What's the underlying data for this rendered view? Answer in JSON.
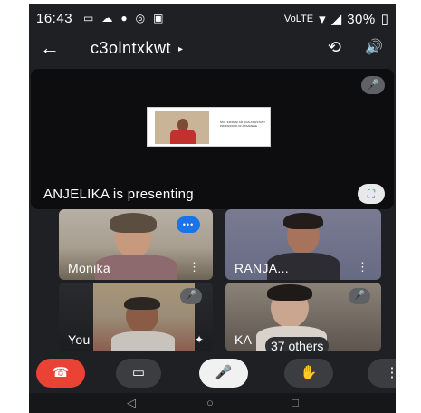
{
  "status_bar": {
    "time": "16:43",
    "left_icons": [
      "cast-icon",
      "cloud-icon",
      "mic-icon",
      "camera-icon",
      "media-icon"
    ],
    "volte_label": "VoLTE",
    "battery_percent": "30%"
  },
  "header": {
    "back_glyph": "←",
    "meeting_code": "c3olntxkwt",
    "caret_glyph": "▸",
    "switch_camera_glyph": "⟲",
    "speaker_glyph": "🔊"
  },
  "presentation": {
    "presenter_label": "ANJELIKA is presenting",
    "slide_caption": "SMT. INDRANI KR. DAS ASSISTANT PROFESSOR OF ASSAMESE",
    "fullscreen_glyph": "⛶",
    "muted_glyph": "🎤"
  },
  "participants": [
    {
      "name": "Monika",
      "speaking_glyph": "•••"
    },
    {
      "name": "RANJA..."
    },
    {
      "name": "You"
    },
    {
      "name": "KA",
      "others_label": "37 others"
    }
  ],
  "controls": {
    "end_call_glyph": "☎",
    "video_glyph": "▭",
    "mic_glyph": "🎤",
    "hand_glyph": "✋",
    "more_glyph": "⋮"
  },
  "nav": {
    "back_glyph": "◁",
    "home_glyph": "○",
    "recents_glyph": "□"
  },
  "colors": {
    "background": "#1f2023",
    "end_call": "#ea4335",
    "speaking_indicator": "#1a73e8",
    "control_button": "#3c3d41"
  }
}
